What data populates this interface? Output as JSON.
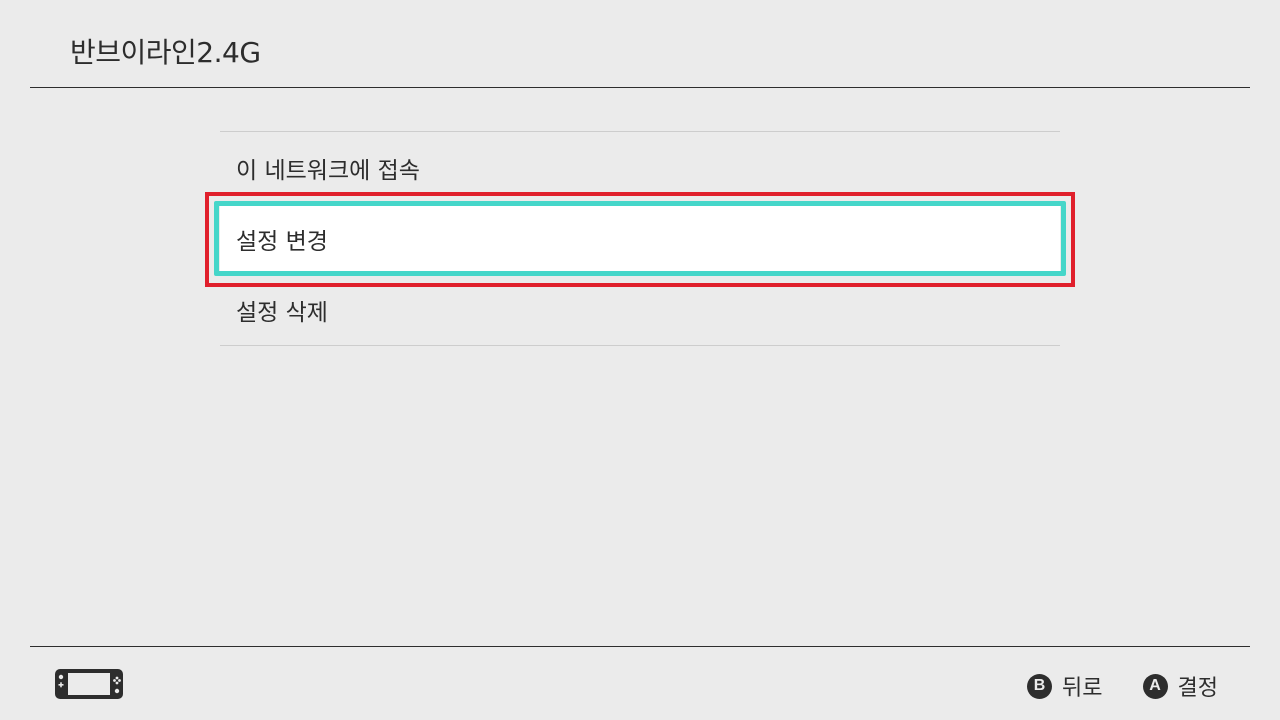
{
  "header": {
    "title": "반브이라인2.4G"
  },
  "menu": {
    "items": [
      {
        "label": "이 네트워크에 접속",
        "selected": false
      },
      {
        "label": "설정 변경",
        "selected": true
      },
      {
        "label": "설정 삭제",
        "selected": false
      }
    ]
  },
  "footer": {
    "console_icon": "handheld-console-icon",
    "actions": [
      {
        "button": "B",
        "label": "뒤로"
      },
      {
        "button": "A",
        "label": "결정"
      }
    ]
  },
  "colors": {
    "background": "#ebebeb",
    "text": "#2d2d2d",
    "selection": "#45d6c9",
    "highlight_outline": "#e0202c"
  }
}
